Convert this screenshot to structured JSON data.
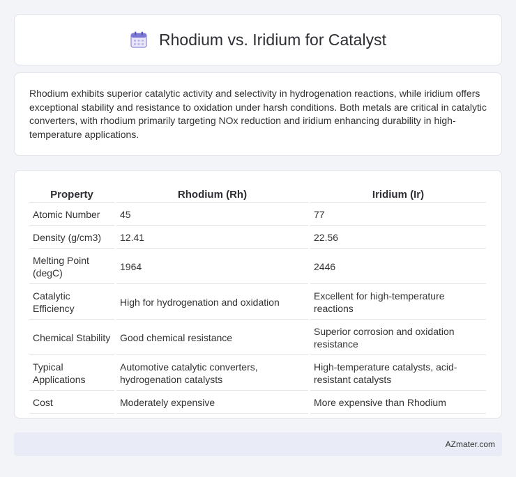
{
  "header": {
    "title": "Rhodium vs. Iridium for Catalyst",
    "icon": "calendar-icon"
  },
  "intro": {
    "text": "Rhodium exhibits superior catalytic activity and selectivity in hydrogenation reactions, while iridium offers exceptional stability and resistance to oxidation under harsh conditions. Both metals are critical in catalytic converters, with rhodium primarily targeting NOx reduction and iridium enhancing durability in high-temperature applications."
  },
  "table": {
    "headers": [
      "Property",
      "Rhodium (Rh)",
      "Iridium (Ir)"
    ],
    "rows": [
      [
        "Atomic Number",
        "45",
        "77"
      ],
      [
        "Density (g/cm3)",
        "12.41",
        "22.56"
      ],
      [
        "Melting Point (degC)",
        "1964",
        "2446"
      ],
      [
        "Catalytic Efficiency",
        "High for hydrogenation and oxidation",
        "Excellent for high-temperature reactions"
      ],
      [
        "Chemical Stability",
        "Good chemical resistance",
        "Superior corrosion and oxidation resistance"
      ],
      [
        "Typical Applications",
        "Automotive catalytic converters, hydrogenation catalysts",
        "High-temperature catalysts, acid-resistant catalysts"
      ],
      [
        "Cost",
        "Moderately expensive",
        "More expensive than Rhodium"
      ]
    ]
  },
  "footer": {
    "text": "AZmater.com"
  }
}
